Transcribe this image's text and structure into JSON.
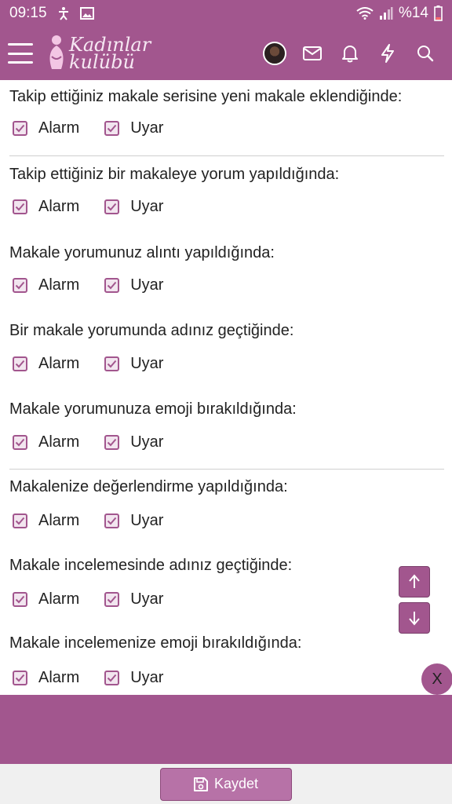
{
  "status_bar": {
    "time": "09:15",
    "battery": "%14",
    "icons": [
      "accessibility-icon",
      "image-icon",
      "wifi-icon",
      "signal-icon",
      "battery-icon"
    ]
  },
  "app_bar": {
    "logo_line1": "Kadınlar",
    "logo_line2": "kulübü",
    "icons": [
      "menu-icon",
      "avatar",
      "mail-icon",
      "bell-icon",
      "bolt-icon",
      "search-icon"
    ]
  },
  "preferences": [
    {
      "title": "Takip ettiğiniz makale serisine yeni makale eklendiğinde:",
      "alarm": "Alarm",
      "uyar": "Uyar",
      "alarm_checked": true,
      "uyar_checked": true
    },
    {
      "title": "Takip ettiğiniz bir makaleye yorum yapıldığında:",
      "alarm": "Alarm",
      "uyar": "Uyar",
      "alarm_checked": true,
      "uyar_checked": true
    },
    {
      "title": "Makale yorumunuz alıntı yapıldığında:",
      "alarm": "Alarm",
      "uyar": "Uyar",
      "alarm_checked": true,
      "uyar_checked": true
    },
    {
      "title": "Bir makale yorumunda adınız geçtiğinde:",
      "alarm": "Alarm",
      "uyar": "Uyar",
      "alarm_checked": true,
      "uyar_checked": true
    },
    {
      "title": "Makale yorumunuza emoji bırakıldığında:",
      "alarm": "Alarm",
      "uyar": "Uyar",
      "alarm_checked": true,
      "uyar_checked": true
    },
    {
      "title": "Makalenize değerlendirme yapıldığında:",
      "alarm": "Alarm",
      "uyar": "Uyar",
      "alarm_checked": true,
      "uyar_checked": true
    },
    {
      "title": "Makale incelemesinde adınız geçtiğinde:",
      "alarm": "Alarm",
      "uyar": "Uyar",
      "alarm_checked": true,
      "uyar_checked": true
    },
    {
      "title": "Makale incelemenize emoji bırakıldığında:",
      "alarm": "Alarm",
      "uyar": "Uyar",
      "alarm_checked": true,
      "uyar_checked": true
    }
  ],
  "scroll_buttons": {
    "up_icon": "arrow-up-icon",
    "down_icon": "arrow-down-icon"
  },
  "close_button": {
    "label": "X"
  },
  "save_button": {
    "label": "Kaydet",
    "icon": "save-icon"
  },
  "colors": {
    "brand": "#a2568e",
    "checkbox_fill": "#f2e5ef",
    "save_button": "#b772a7"
  }
}
